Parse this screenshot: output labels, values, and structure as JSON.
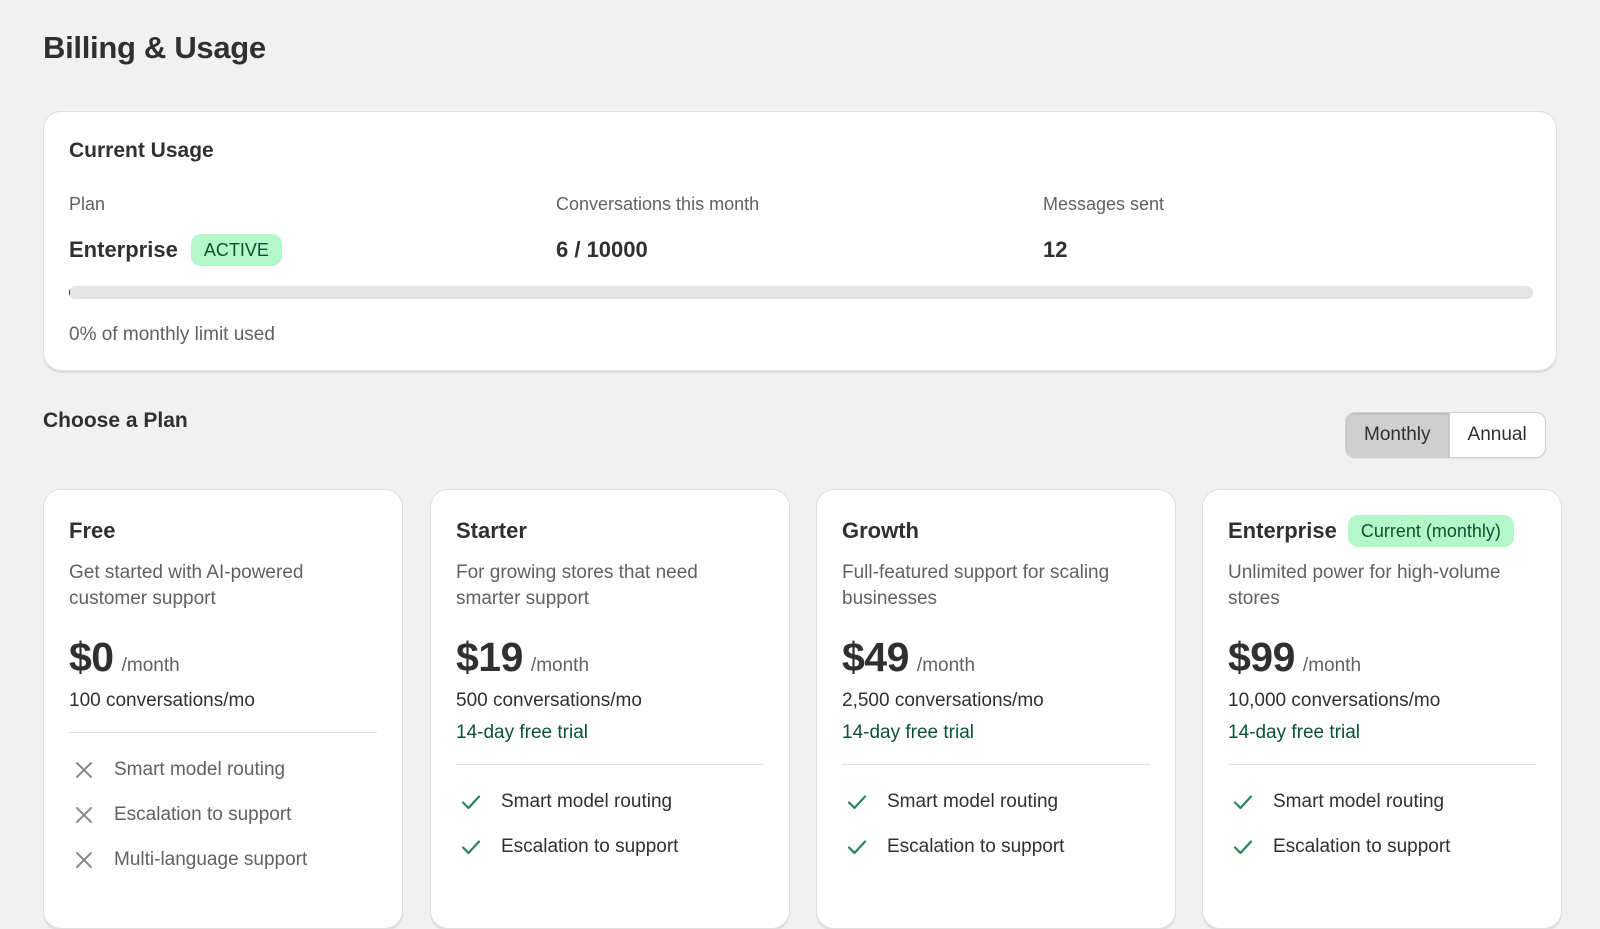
{
  "page": {
    "title": "Billing & Usage"
  },
  "usage": {
    "title": "Current Usage",
    "plan_label": "Plan",
    "plan_value": "Enterprise",
    "plan_status": "ACTIVE",
    "conversations_label": "Conversations this month",
    "conversations_value": "6 / 10000",
    "messages_label": "Messages sent",
    "messages_value": "12",
    "progress_fraction": 0.0006,
    "note": "0% of monthly limit used"
  },
  "plans_section": {
    "title": "Choose a Plan",
    "toggle": {
      "options": [
        "Monthly",
        "Annual"
      ],
      "selected": "Monthly"
    }
  },
  "plans": [
    {
      "name": "Free",
      "badge": "",
      "description": "Get started with AI-powered customer support",
      "price": "$0",
      "per": "/month",
      "quota": "100 conversations/mo",
      "trial": "",
      "features": [
        {
          "label": "Smart model routing",
          "included": false
        },
        {
          "label": "Escalation to support",
          "included": false
        },
        {
          "label": "Multi-language support",
          "included": false
        }
      ]
    },
    {
      "name": "Starter",
      "badge": "",
      "description": "For growing stores that need smarter support",
      "price": "$19",
      "per": "/month",
      "quota": "500 conversations/mo",
      "trial": "14-day free trial",
      "features": [
        {
          "label": "Smart model routing",
          "included": true
        },
        {
          "label": "Escalation to support",
          "included": true
        }
      ]
    },
    {
      "name": "Growth",
      "badge": "",
      "description": "Full-featured support for scaling businesses",
      "price": "$49",
      "per": "/month",
      "quota": "2,500 conversations/mo",
      "trial": "14-day free trial",
      "features": [
        {
          "label": "Smart model routing",
          "included": true
        },
        {
          "label": "Escalation to support",
          "included": true
        }
      ]
    },
    {
      "name": "Enterprise",
      "badge": "Current (monthly)",
      "description": "Unlimited power for high-volume stores",
      "price": "$99",
      "per": "/month",
      "quota": "10,000 conversations/mo",
      "trial": "14-day free trial",
      "features": [
        {
          "label": "Smart model routing",
          "included": true
        },
        {
          "label": "Escalation to support",
          "included": true
        }
      ]
    }
  ],
  "icons": {
    "included": "check-icon",
    "excluded": "x-icon"
  },
  "colors": {
    "background": "#f1f1f1",
    "card": "#ffffff",
    "badge_bg": "#b4f7c8",
    "badge_text": "#0c5132",
    "trial_text": "#0c5132",
    "check": "#29845a",
    "cross": "#8a8a8a",
    "progress_track": "#e3e3e3"
  }
}
